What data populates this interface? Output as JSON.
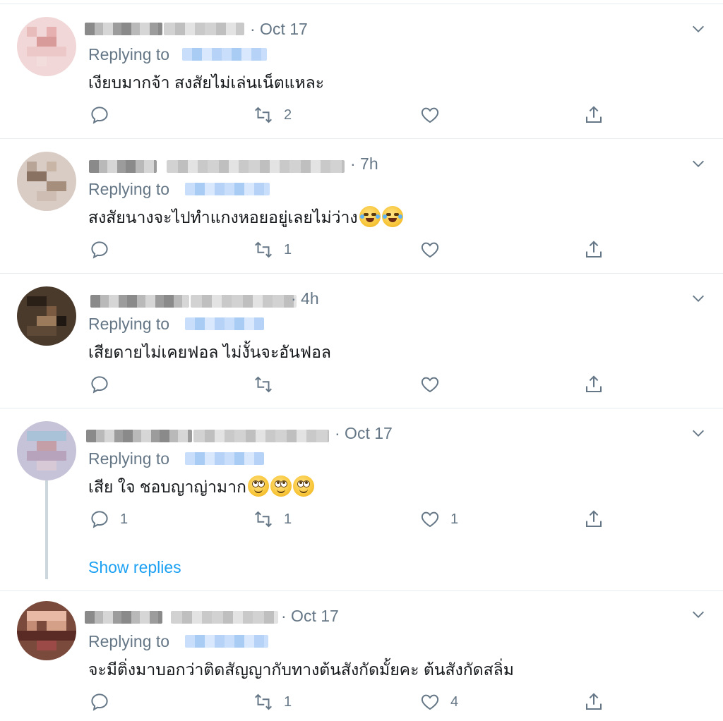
{
  "tweets": [
    {
      "time": "· Oct 17",
      "replying_to": "Replying to",
      "text": "เงียบมากจ้า สงสัยไม่เล่นเน็ตแหละ",
      "emojis": [],
      "reply_count": "",
      "retweet_count": "2",
      "like_count": ""
    },
    {
      "time": "· 7h",
      "replying_to": "Replying to",
      "text": "สงสัยนางจะไปทำแกงหอยอยู่เลยไม่ว่าง",
      "emojis": [
        "rolling-on-floor-laughing",
        "rolling-on-floor-laughing"
      ],
      "reply_count": "",
      "retweet_count": "1",
      "like_count": ""
    },
    {
      "time": "· 4h",
      "replying_to": "Replying to",
      "text": "เสียดายไม่เคยฟอล ไม่งั้นจะอันฟอล",
      "emojis": [],
      "reply_count": "",
      "retweet_count": "",
      "like_count": ""
    },
    {
      "time": "· Oct 17",
      "replying_to": "Replying to",
      "text": "เสีย ใจ ชอบญาญ่ามาก",
      "emojis": [
        "face-with-rolling-eyes",
        "face-with-rolling-eyes",
        "face-with-rolling-eyes"
      ],
      "reply_count": "1",
      "retweet_count": "1",
      "like_count": "1",
      "show_replies": "Show replies"
    },
    {
      "time": "· Oct 17",
      "replying_to": "Replying to",
      "text": "จะมีติ่งมาบอกว่าติดสัญญากับทางต้นสังกัดมั้ยคะ ต้นสังกัดสลิ่ม",
      "emojis": [],
      "reply_count": "",
      "retweet_count": "1",
      "like_count": "4"
    }
  ],
  "icons": {
    "reply": "reply-icon",
    "retweet": "retweet-icon",
    "like": "heart-icon",
    "share": "share-icon",
    "more": "chevron-down-icon"
  },
  "colors": {
    "secondary_text": "#657786",
    "link": "#1da1f2",
    "divider": "#e6ecf0"
  }
}
